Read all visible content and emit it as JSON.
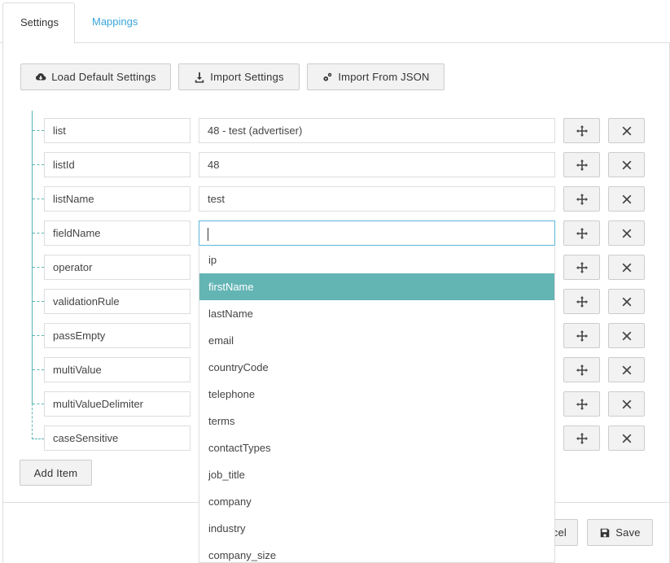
{
  "tabs": [
    {
      "label": "Settings",
      "active": true
    },
    {
      "label": "Mappings",
      "active": false
    }
  ],
  "toolbar": {
    "load_defaults_label": "Load Default Settings",
    "import_settings_label": "Import Settings",
    "import_json_label": "Import From JSON"
  },
  "rows": [
    {
      "key": "list",
      "value": "48 - test (advertiser)"
    },
    {
      "key": "listId",
      "value": "48"
    },
    {
      "key": "listName",
      "value": "test"
    },
    {
      "key": "fieldName",
      "value": ""
    },
    {
      "key": "operator",
      "value": ""
    },
    {
      "key": "validationRule",
      "value": ""
    },
    {
      "key": "passEmpty",
      "value": ""
    },
    {
      "key": "multiValue",
      "value": ""
    },
    {
      "key": "multiValueDelimiter",
      "value": ""
    },
    {
      "key": "caseSensitive",
      "value": ""
    }
  ],
  "add_item_label": "Add Item",
  "footer": {
    "cancel_partial_label": "cel",
    "save_label": "Save"
  },
  "dropdown": {
    "highlighted": "firstName",
    "options": [
      "ip",
      "firstName",
      "lastName",
      "email",
      "countryCode",
      "telephone",
      "terms",
      "contactTypes",
      "job_title",
      "company",
      "industry",
      "company_size"
    ]
  },
  "colors": {
    "accent_link": "#3aa6d8",
    "highlight": "#63b5b4",
    "tree_line": "#5bb5b3"
  }
}
